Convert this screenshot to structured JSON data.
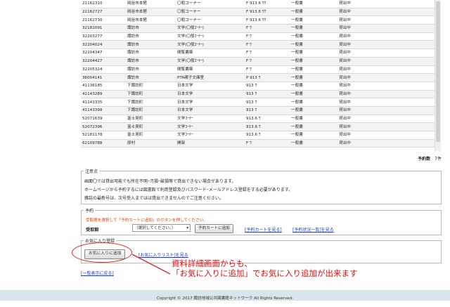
{
  "holdings": {
    "rows": [
      {
        "id": "21162310",
        "library": "岡谷市本館",
        "location": "〇般コーナー",
        "call_no": "F 913.6 ﾜｸ",
        "category": "一般書",
        "status": "貸出中"
      },
      {
        "id": "21162727",
        "library": "岡谷市本館",
        "location": "〇般コーナー",
        "call_no": "F 913.6 ﾜｸ",
        "category": "一般書",
        "status": "貸出中"
      },
      {
        "id": "21162730",
        "library": "岡谷市本館",
        "location": "〇般コーナー",
        "call_no": "F 913.6 ﾜｸ",
        "category": "一般書",
        "status": "貸出中"
      },
      {
        "id": "32182091",
        "library": "諏訪市",
        "location": "文学(〇般ｺｰﾅｰ)",
        "call_no": "F ﾜ",
        "category": "一般書",
        "status": "貸出中"
      },
      {
        "id": "32203277",
        "library": "諏訪市",
        "location": "文学(〇般ｺｰﾅｰ)",
        "call_no": "F ﾜ",
        "category": "一般書",
        "status": "貸出中"
      },
      {
        "id": "32204024",
        "library": "諏訪市",
        "location": "文学(〇般ｺｰﾅｰ)",
        "call_no": "F ﾜ",
        "category": "一般書",
        "status": "貸出中"
      },
      {
        "id": "32204347",
        "library": "諏訪市",
        "location": "閲覧書庫",
        "call_no": "F ﾜ",
        "category": "一般書",
        "status": "貸出中"
      },
      {
        "id": "32204427",
        "library": "諏訪市",
        "location": "文学(〇般ｺｰﾅｰ)",
        "call_no": "F ﾜ",
        "category": "一般書",
        "status": "貸出中"
      },
      {
        "id": "32205324",
        "library": "諏訪市",
        "location": "閲覧書庫",
        "call_no": "F ﾜ",
        "category": "一般書",
        "status": "貸出中"
      },
      {
        "id": "36004141",
        "library": "諏訪市",
        "location": "PTA親子文庫室",
        "call_no": "P 913 ﾜ",
        "category": "一般書",
        "status": "貸出中"
      },
      {
        "id": "41136185",
        "library": "下諏訪町",
        "location": "日本文学",
        "call_no": "913 ﾜ",
        "category": "一般書",
        "status": "貸出中"
      },
      {
        "id": "41143289",
        "library": "下諏訪町",
        "location": "日本文学",
        "call_no": "913 ﾜ",
        "category": "一般書",
        "status": "貸出中"
      },
      {
        "id": "41143335",
        "library": "下諏訪町",
        "location": "日本文学",
        "call_no": "913 ﾜ",
        "category": "一般書",
        "status": "貸出中"
      },
      {
        "id": "41143399",
        "library": "下諏訪町",
        "location": "日本文学",
        "call_no": "913 ﾜ",
        "category": "一般書",
        "status": "貸出中"
      },
      {
        "id": "52071639",
        "library": "富士見町",
        "location": "文学ｺｰﾅｰ",
        "call_no": "913.6 ﾜ",
        "category": "一般書",
        "status": "貸出中"
      },
      {
        "id": "52072396",
        "library": "富士見町",
        "location": "文学ｺｰﾅｰ",
        "call_no": "913.6 ﾜ",
        "category": "一般書",
        "status": "貸出中"
      },
      {
        "id": "52181178",
        "library": "富士見町",
        "location": "文学ｺｰﾅｰ",
        "call_no": "913.6 ﾜ",
        "category": "一般書",
        "status": "貸出中"
      },
      {
        "id": "62109788",
        "library": "原村",
        "location": "開架",
        "call_no": "F ﾜ",
        "category": "一般書",
        "status": "貸出中"
      }
    ]
  },
  "reservation_count": {
    "label": "予約数",
    "value": "7件"
  },
  "notes": {
    "legend": "注意点",
    "lines": [
      "画面〇では貸出可能でも所在不明･汚損･破損等で貸出できない場合があります。",
      "ホームページから予約するには図書館で利用登録及びパスワード･メールアドレス登録をする必要があります。",
      "雑誌の最新号は、次号受入まではは貸出できませんのでご注意ください。"
    ]
  },
  "reserve": {
    "legend": "予約",
    "hint": "受取館を選択して「予約カートに追加」のボタンを押してください。",
    "pickup_label": "受取館",
    "select_value": "（選択してください。）",
    "add_button": "予約カートに追加",
    "cart_link": "[予約カートを見る]",
    "status_link": "[予約状況一覧]を見る"
  },
  "favorites": {
    "legend": "お気に入り登録",
    "add_button": "お気に入りに追加",
    "list_link": "[お気に入りリスト]を見る"
  },
  "back_link": "[一覧表示に戻る]",
  "callout": {
    "line1": "資料詳細画面からも、",
    "line2": "「お気に入りに追加」でお気に入り追加が出来ます"
  },
  "footer": "Copyright © 2017 諏訪地域公共図書館ネットワーク All Rights Reserved.",
  "colors": {
    "annotation": "#e02020",
    "hint": "#d04000",
    "link": "#1a3cc8",
    "footer_bg": "#d8e5ea"
  }
}
